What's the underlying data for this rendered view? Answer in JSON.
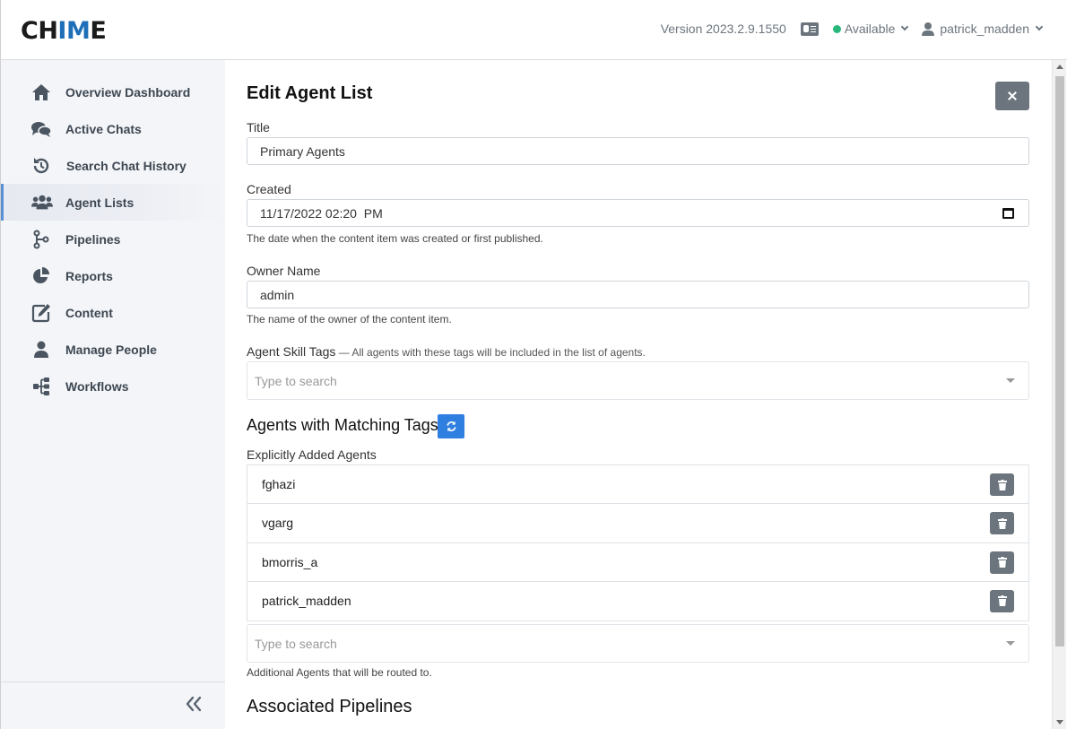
{
  "header": {
    "logo": {
      "part1": "CH",
      "part2": "IM",
      "part3": "E"
    },
    "version": "Version 2023.2.9.1550",
    "status": "Available",
    "status_color": "#28b67a",
    "username": "patrick_madden",
    "icons": {
      "contact_card": "id-card-icon",
      "user": "user-icon"
    }
  },
  "sidebar": {
    "items": [
      {
        "label": "Overview Dashboard",
        "icon": "home-icon"
      },
      {
        "label": "Active Chats",
        "icon": "chat-bubbles-icon"
      },
      {
        "label": "Search Chat History",
        "icon": "history-icon"
      },
      {
        "label": "Agent Lists",
        "icon": "users-icon",
        "active": true
      },
      {
        "label": "Pipelines",
        "icon": "branch-icon"
      },
      {
        "label": "Reports",
        "icon": "pie-chart-icon"
      },
      {
        "label": "Content",
        "icon": "edit-icon"
      },
      {
        "label": "Manage People",
        "icon": "user-icon"
      },
      {
        "label": "Workflows",
        "icon": "sitemap-icon"
      }
    ],
    "accent": "#5b8fd6"
  },
  "main": {
    "title": "Edit Agent List",
    "form": {
      "title_label": "Title",
      "title_value": "Primary Agents",
      "created_label": "Created",
      "created_value": "11/17/2022 02:20  PM",
      "created_help": "The date when the content item was created or first published.",
      "owner_label": "Owner Name",
      "owner_value": "admin",
      "owner_help": "The name of the owner of the content item.",
      "skill_tags_label": "Agent Skill Tags",
      "skill_tags_desc": " — All agents with these tags will be included in the list of agents.",
      "skill_tags_placeholder": "Type to search"
    },
    "matching": {
      "heading": "Agents with Matching Tags",
      "refresh_color": "#2f7fe0"
    },
    "explicit": {
      "label": "Explicitly Added Agents",
      "agents": [
        "fghazi",
        "vgarg",
        "bmorris_a",
        "patrick_madden"
      ],
      "search_placeholder": "Type to search",
      "help": "Additional Agents that will be routed to."
    },
    "pipelines": {
      "heading": "Associated Pipelines"
    }
  }
}
